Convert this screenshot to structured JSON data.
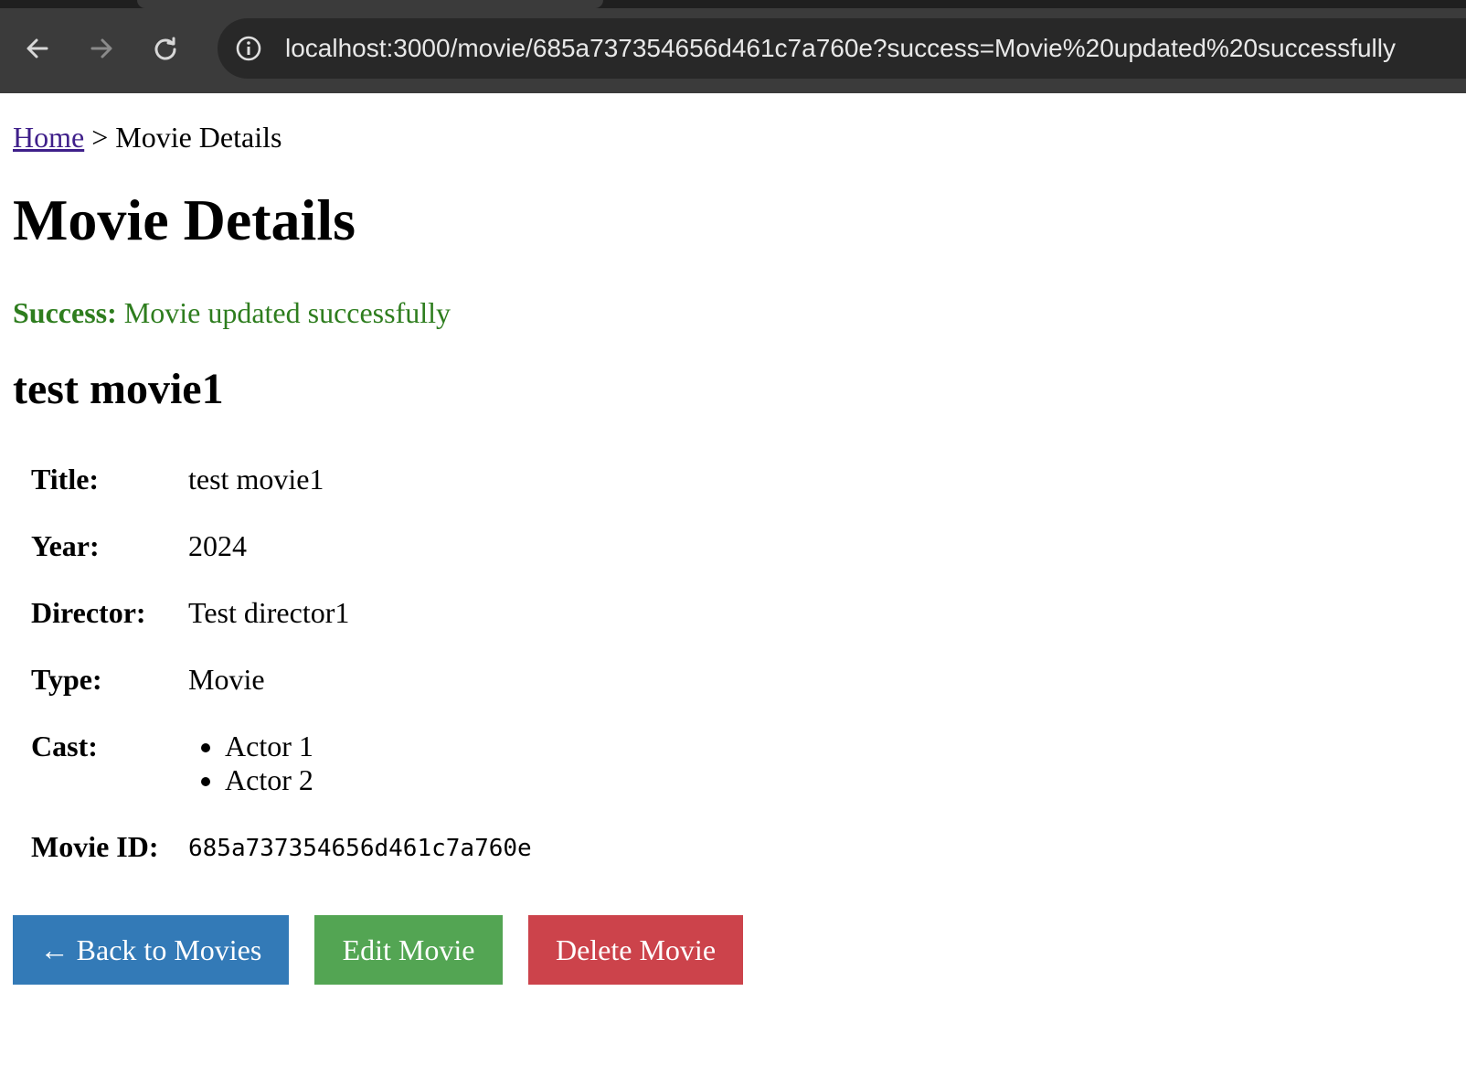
{
  "browser": {
    "url": "localhost:3000/movie/685a737354656d461c7a760e?success=Movie%20updated%20successfully"
  },
  "breadcrumb": {
    "home_label": "Home",
    "separator": ">",
    "current": "Movie Details"
  },
  "page": {
    "title": "Movie Details"
  },
  "alert": {
    "label": "Success:",
    "message": "Movie updated successfully",
    "color": "#2e7d1e"
  },
  "movie": {
    "heading": "test movie1",
    "title_label": "Title:",
    "title": "test movie1",
    "year_label": "Year:",
    "year": "2024",
    "director_label": "Director:",
    "director": "Test director1",
    "type_label": "Type:",
    "type": "Movie",
    "cast_label": "Cast:",
    "cast": [
      "Actor 1",
      "Actor 2"
    ],
    "id_label": "Movie ID:",
    "id": "685a737354656d461c7a760e"
  },
  "actions": {
    "back_label": "← Back to Movies",
    "edit_label": "Edit Movie",
    "delete_label": "Delete Movie",
    "back_color": "#337ab7",
    "edit_color": "#53a553",
    "delete_color": "#cc434b"
  }
}
